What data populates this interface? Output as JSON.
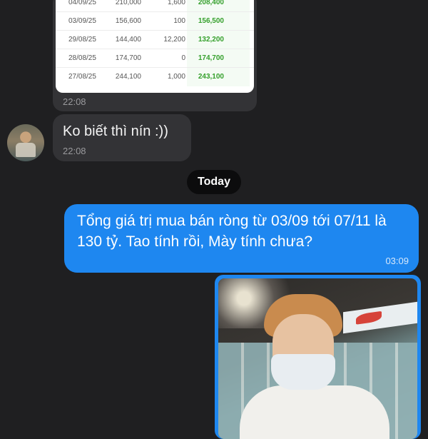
{
  "shared_table": {
    "rows": [
      {
        "date": "04/09/25",
        "a": "210,000",
        "b": "1,600",
        "net": "208,400"
      },
      {
        "date": "03/09/25",
        "a": "156,600",
        "b": "100",
        "net": "156,500"
      },
      {
        "date": "29/08/25",
        "a": "144,400",
        "b": "12,200",
        "net": "132,200"
      },
      {
        "date": "28/08/25",
        "a": "174,700",
        "b": "0",
        "net": "174,700"
      },
      {
        "date": "27/08/25",
        "a": "244,100",
        "b": "1,000",
        "net": "243,100"
      }
    ],
    "time": "22:08"
  },
  "incoming_message": {
    "text": "Ko biết thì nín :))",
    "time": "22:08"
  },
  "day_separator": "Today",
  "outgoing_message": {
    "text": "Tổng giá trị mua bán ròng từ 03/09 tới 07/11 là 130 tỷ. Tao tính rồi, Mày tính chưa?",
    "time": "03:09"
  },
  "colors": {
    "outgoing_bubble": "#1e87f0",
    "incoming_bubble": "#333336",
    "net_value_green": "#35a02c"
  }
}
